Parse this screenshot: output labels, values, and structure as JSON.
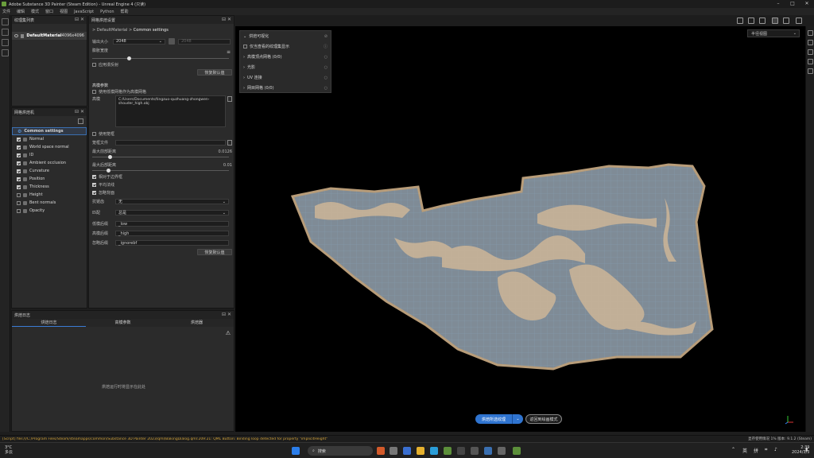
{
  "window": {
    "title": "Adobe Substance 3D Painter (Steam Edition) - Unreal Engine 4 (只读)"
  },
  "menu": [
    "文件",
    "编辑",
    "模式",
    "窗口",
    "视图",
    "JavaScript",
    "Python",
    "帮助"
  ],
  "texture_set_panel": {
    "title": "纹理集列表",
    "layer_name": "DefaultMaterial",
    "resolution": "4096x4096"
  },
  "baker_list_panel": {
    "title": "网格烘焙机",
    "items": [
      {
        "label": "Common settings",
        "checked": null
      },
      {
        "label": "Normal",
        "checked": true
      },
      {
        "label": "World space normal",
        "checked": true
      },
      {
        "label": "ID",
        "checked": true
      },
      {
        "label": "Ambient occlusion",
        "checked": true
      },
      {
        "label": "Curvature",
        "checked": true
      },
      {
        "label": "Position",
        "checked": true
      },
      {
        "label": "Thickness",
        "checked": true
      },
      {
        "label": "Height",
        "checked": false
      },
      {
        "label": "Bent normals",
        "checked": false
      },
      {
        "label": "Opacity",
        "checked": false
      }
    ]
  },
  "bake_settings_panel": {
    "title": "网格烘焙设置",
    "breadcrumb_root": "DefaultMaterial",
    "breadcrumb_sep": ">",
    "breadcrumb_current": "Common settings",
    "output_size_label": "输出大小",
    "output_size_value": "2048",
    "output_size_linked": "2048",
    "dilation_label": "膨胀宽度",
    "apply_diffusion_label": "应用漫反射",
    "reset_label": "恢复默认值",
    "high_poly_section": "高模参数",
    "use_lowpoly_label": "使用低模网格作为高模网格",
    "mesh_label": "高模",
    "mesh_path": "C:/Users/Documents/tingzuo-quzhuang-zhongwen-shouder_high.obj",
    "use_cage_label": "使用笼框",
    "cage_file_label": "笼框文件",
    "max_frontal_label": "最大前部距离",
    "max_frontal_value": "0.0126",
    "max_rear_label": "最大后部距离",
    "max_rear_value": "0.01",
    "relative_label": "相对于边界框",
    "average_label": "平均法线",
    "ignore_backface_label": "忽略背面",
    "antialias_label": "抗锯齿",
    "antialias_value": "无",
    "match_label": "匹配",
    "match_value": "总是",
    "lowpoly_suffix_label": "低模后缀",
    "lowpoly_suffix_value": "_low",
    "highpoly_suffix_label": "高模后缀",
    "highpoly_suffix_value": "_high",
    "ignore_suffix_label": "忽略后缀",
    "ignore_suffix_value": "_ignorebf",
    "reset_label2": "恢复默认值"
  },
  "log_panel": {
    "title": "烘焙日志",
    "tabs": [
      "烘焙日志",
      "高模参数",
      "烘焙器"
    ],
    "empty_text": "烘焙运行时将显示在此处"
  },
  "viewport": {
    "menu_title": "烘焙可视化",
    "menu_items": [
      {
        "label": "仅当查看的纹理集显示",
        "value": ""
      },
      {
        "label": "高模顶点网格 (0/0)",
        "value": ""
      },
      {
        "label": "光影",
        "value": ""
      },
      {
        "label": "UV 连接",
        "value": ""
      },
      {
        "label": "网目网格 (0/0)",
        "value": ""
      }
    ],
    "camera_select": "半径视图",
    "bake_button": "烘焙所选纹理",
    "return_button": "返回到绘画模式"
  },
  "status": {
    "message": "[Script] file:///C:/Program Files/Steam/steamapps/common/Substance 3D Painter 2023/qml/BakingDialog.qml:209:21: QML Button: Binding loop detected for property \"implicitHeight\"",
    "right": "显存使用情况  1%  版本: 9.1.2 (Steam)"
  },
  "taskbar": {
    "weather_temp": "3°C",
    "weather_desc": "多云",
    "search_placeholder": "搜索",
    "time": "2:39",
    "date": "2024/3/3",
    "lang": "英",
    "ime": "拼"
  },
  "colors": {
    "accent": "#2f74d0",
    "status_warn": "#d1a23a"
  }
}
